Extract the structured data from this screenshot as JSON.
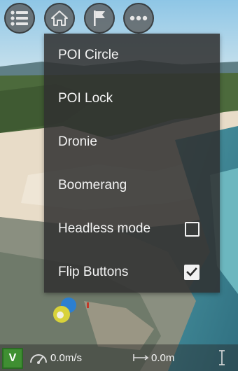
{
  "toolbar": {
    "buttons": [
      {
        "icon": "list-icon"
      },
      {
        "icon": "home-icon"
      },
      {
        "icon": "flag-icon"
      },
      {
        "icon": "more-icon"
      }
    ]
  },
  "menu": {
    "items": [
      {
        "label": "POI Circle",
        "checkbox": null
      },
      {
        "label": "POI Lock",
        "checkbox": null
      },
      {
        "label": "Dronie",
        "checkbox": null
      },
      {
        "label": "Boomerang",
        "checkbox": null
      },
      {
        "label": "Headless mode",
        "checkbox": false
      },
      {
        "label": "Flip Buttons",
        "checkbox": true
      }
    ]
  },
  "status": {
    "mode": "V",
    "speed": "0.0m/s",
    "distance": "0.0m",
    "altitude": ""
  },
  "colors": {
    "menu_bg": "#303030",
    "mode_badge": "#3f8f32",
    "text": "#f4f4f4"
  }
}
